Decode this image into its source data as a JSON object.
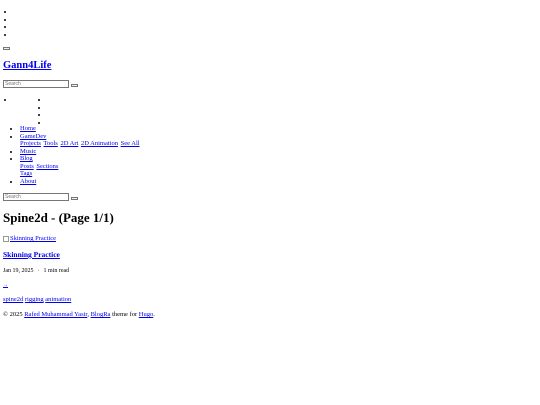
{
  "site": {
    "title": "Gann4Life"
  },
  "search": {
    "placeholder": "Search"
  },
  "nav": {
    "home": "Home",
    "gamedev": "GameDev",
    "gamedev_links": [
      "Projects",
      "Tools",
      "2D Art",
      "2D Animation",
      "See All"
    ],
    "music": "Music",
    "blog": "Blog",
    "blog_links": [
      "Posts",
      "Sections",
      "Tags"
    ],
    "about": "About"
  },
  "page": {
    "title": "Spine2d - (Page 1/1)"
  },
  "post": {
    "image_alt": "Skinning Practice",
    "title": "Skinning Practice",
    "date": "Jan 19, 2025",
    "separator": "·",
    "read_time": "1 min read",
    "read_more": "→",
    "tags": [
      "spine2d",
      "rigging",
      "animation"
    ]
  },
  "footer": {
    "copyright": "© 2025",
    "author": "Rafed Muhammad Yasir",
    "theme": "BlogRa",
    "theme_text": "theme for",
    "hugo": "Hugo",
    "period": "."
  }
}
